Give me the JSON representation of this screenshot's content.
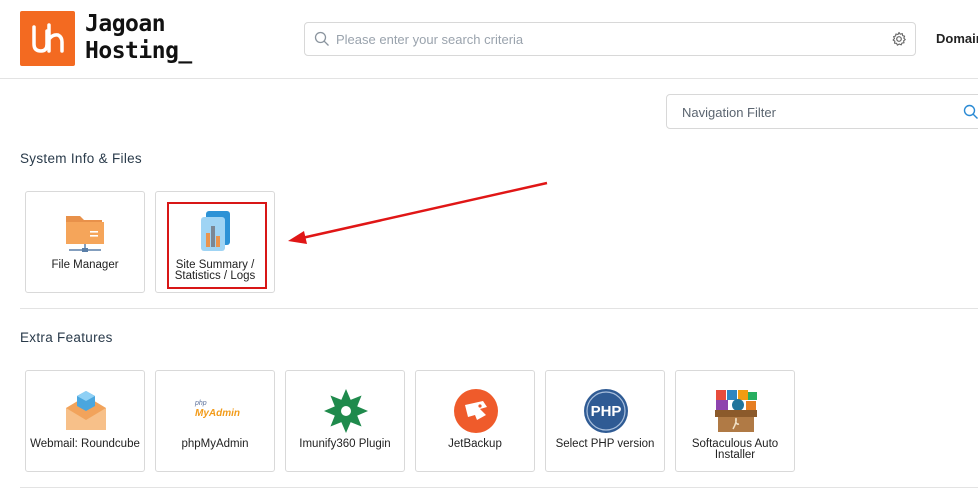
{
  "header": {
    "brand_line1": "Jagoan",
    "brand_line2": "Hosting_",
    "search_placeholder": "Please enter your search criteria",
    "domains_label": "Domains"
  },
  "nav_filter": {
    "placeholder": "Navigation Filter"
  },
  "sections": [
    {
      "title": "System Info & Files",
      "tiles": [
        {
          "label": "File Manager",
          "icon": "folder-icon"
        },
        {
          "label": "Site Summary / Statistics / Logs",
          "icon": "statistics-icon"
        }
      ]
    },
    {
      "title": "Extra Features",
      "tiles": [
        {
          "label": "Webmail: Roundcube",
          "icon": "roundcube-icon"
        },
        {
          "label": "phpMyAdmin",
          "icon": "phpmyadmin-icon",
          "logo_line1": "php",
          "logo_line2": "MyAdmin"
        },
        {
          "label": "Imunify360 Plugin",
          "icon": "imunify360-icon"
        },
        {
          "label": "JetBackup",
          "icon": "jetbackup-icon"
        },
        {
          "label": "Select PHP version",
          "icon": "php-icon",
          "logo_text": "PHP"
        },
        {
          "label": "Softaculous Auto Installer",
          "icon": "softaculous-icon"
        }
      ]
    }
  ],
  "colors": {
    "brand_orange": "#f36a21",
    "highlight_red": "#d81616",
    "text_dark": "#293a4a"
  }
}
